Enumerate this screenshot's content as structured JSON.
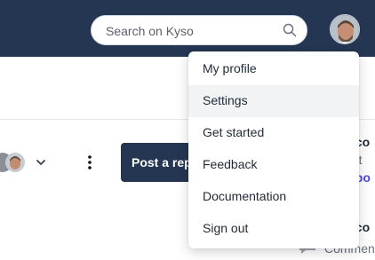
{
  "search": {
    "placeholder": "Search on Kyso"
  },
  "post_button": {
    "label": "Post a report"
  },
  "background": {
    "right_texts": [
      "sco",
      "d t",
      "epo",
      "sco",
      "Commen"
    ]
  },
  "user_menu": {
    "items": [
      {
        "label": "My profile",
        "active": false
      },
      {
        "label": "Settings",
        "active": true
      },
      {
        "label": "Get started",
        "active": false
      },
      {
        "label": "Feedback",
        "active": false
      },
      {
        "label": "Documentation",
        "active": false
      },
      {
        "label": "Sign out",
        "active": false
      }
    ]
  },
  "colors": {
    "navbar": "#243652",
    "link": "#4f46e5"
  },
  "icons": [
    "search-icon",
    "chevron-down-icon",
    "kebab-menu-icon",
    "comment-icon"
  ]
}
